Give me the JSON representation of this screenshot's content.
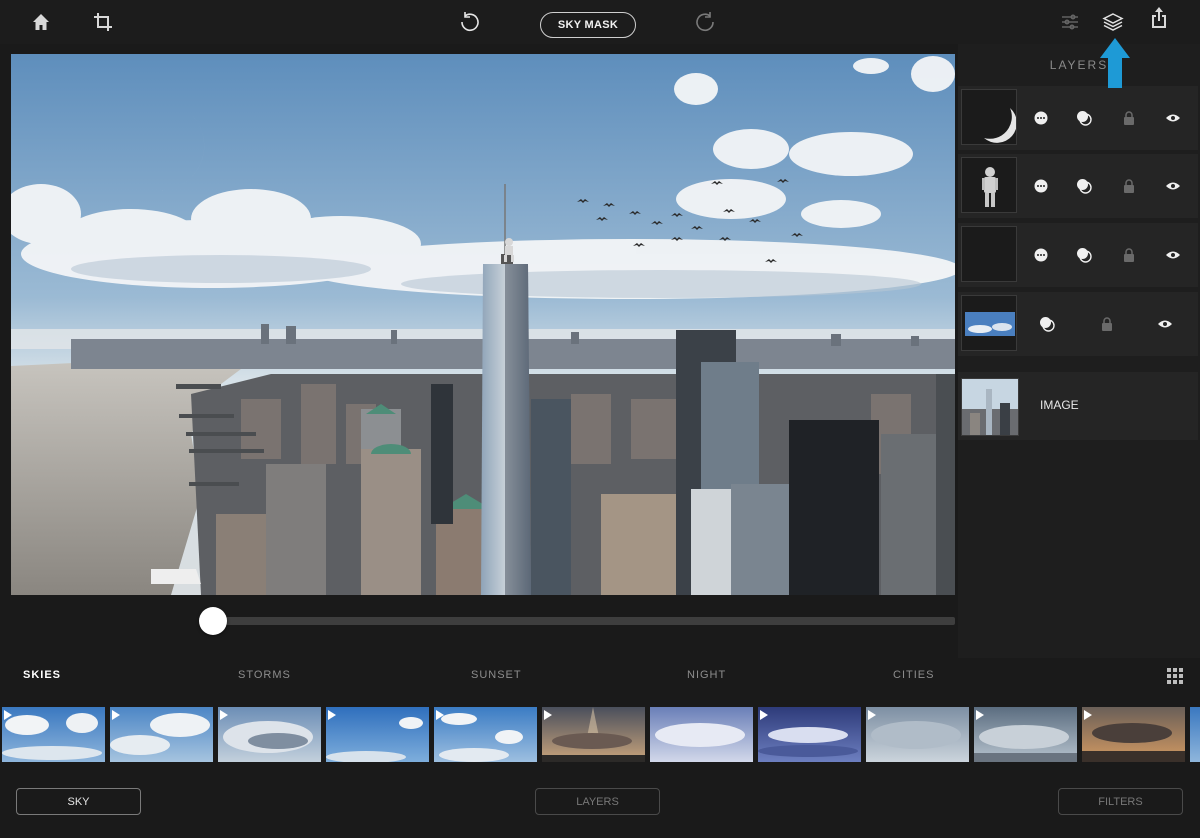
{
  "toolbar": {
    "sky_mask_label": "SKY MASK",
    "icons": [
      "home-icon",
      "crop-icon",
      "undo-icon",
      "redo-icon",
      "adjustments-icon",
      "layers-icon",
      "share-icon"
    ]
  },
  "slider": {
    "value": 0.0
  },
  "layers_panel": {
    "title": "LAYERS",
    "layers": [
      {
        "name": "moon",
        "thumb": "moon"
      },
      {
        "name": "figure",
        "thumb": "astronaut"
      },
      {
        "name": "birds",
        "thumb": "birds"
      },
      {
        "name": "sky",
        "thumb": "sky"
      }
    ],
    "image_label": "IMAGE"
  },
  "categories": [
    {
      "label": "SKIES",
      "active": true
    },
    {
      "label": "STORMS",
      "active": false
    },
    {
      "label": "SUNSET",
      "active": false
    },
    {
      "label": "NIGHT",
      "active": false
    },
    {
      "label": "CITIES",
      "active": false
    }
  ],
  "bottom_buttons": {
    "sky_label": "SKY",
    "layers_label": "LAYERS",
    "filters_label": "FILTERS"
  },
  "colors": {
    "accent_arrow": "#1e9ad6",
    "background": "#1a1a1a",
    "panel": "#252525"
  }
}
